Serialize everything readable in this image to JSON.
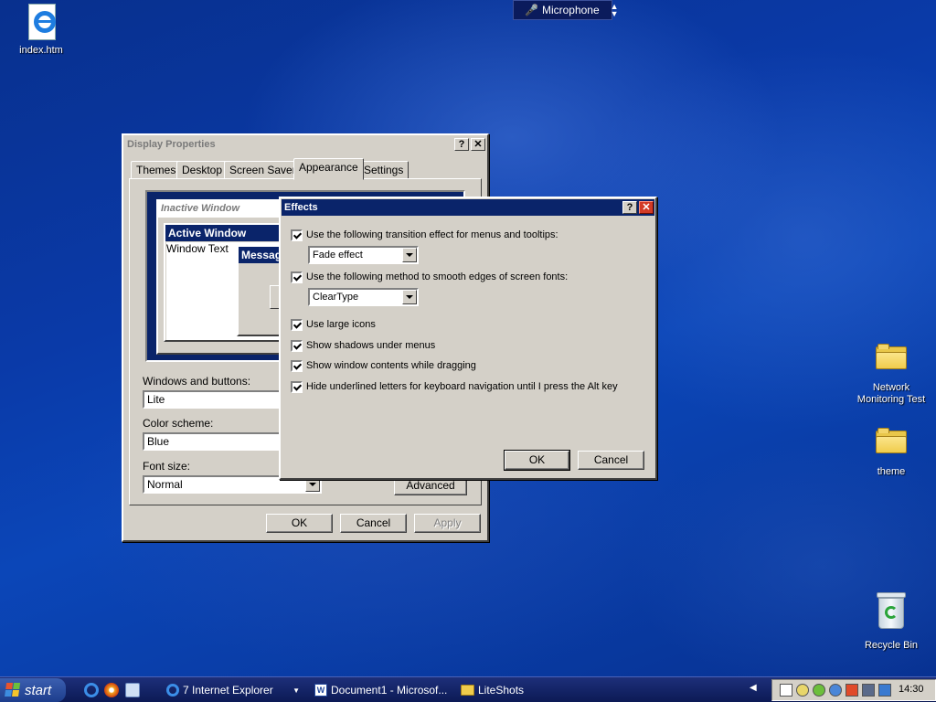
{
  "desktop": {
    "icons": [
      {
        "label": "index.htm",
        "icon": "ie-file-icon"
      },
      {
        "label": "Network Monitoring Test",
        "icon": "folder-icon"
      },
      {
        "label": "theme",
        "icon": "folder-icon"
      },
      {
        "label": "Recycle Bin",
        "icon": "recycle-bin-icon"
      }
    ]
  },
  "language_bar": {
    "label": "Microphone",
    "icon": "microphone-icon"
  },
  "display_properties": {
    "title": "Display Properties",
    "tabs": [
      "Themes",
      "Desktop",
      "Screen Saver",
      "Appearance",
      "Settings"
    ],
    "selected_tab": "Appearance",
    "preview": {
      "inactive_title": "Inactive Window",
      "active_title": "Active Window",
      "window_text": "Window Text",
      "message_title": "Message Box"
    },
    "windows_and_buttons_label": "Windows and buttons:",
    "windows_and_buttons_value": "Lite",
    "color_scheme_label": "Color scheme:",
    "color_scheme_value": "Blue",
    "font_size_label": "Font size:",
    "font_size_value": "Normal",
    "advanced_button": "Advanced",
    "ok_button": "OK",
    "cancel_button": "Cancel",
    "apply_button": "Apply"
  },
  "effects": {
    "title": "Effects",
    "transition_label": "Use the following transition effect for menus and tooltips:",
    "transition_value": "Fade effect",
    "smoothing_label": "Use the following method to smooth edges of screen fonts:",
    "smoothing_value": "ClearType",
    "large_icons_label": "Use large icons",
    "shadows_label": "Show shadows under menus",
    "drag_contents_label": "Show window contents while dragging",
    "hide_underline_label": "Hide underlined letters for keyboard navigation until I press the Alt key",
    "checked": {
      "transition": true,
      "smoothing": true,
      "large_icons": true,
      "shadows": true,
      "drag_contents": true,
      "hide_underline": true
    },
    "ok_button": "OK",
    "cancel_button": "Cancel"
  },
  "taskbar": {
    "start_label": "start",
    "tasks": [
      {
        "label": "7 Internet Explorer",
        "icon": "ie-icon"
      },
      {
        "label": "Document1 - Microsof...",
        "icon": "word-icon"
      },
      {
        "label": "LiteShots",
        "icon": "folder-icon"
      }
    ],
    "clock": "14:30"
  }
}
